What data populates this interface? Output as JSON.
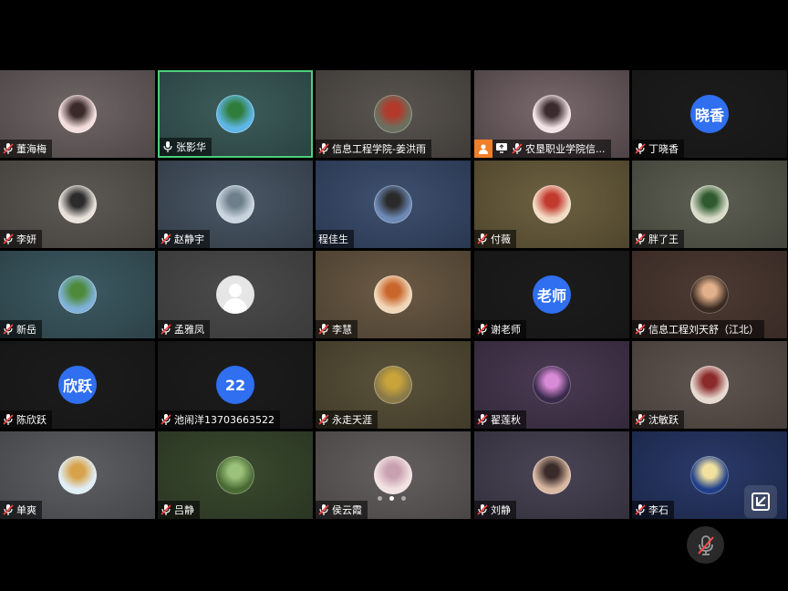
{
  "participants": [
    {
      "name": "董海梅",
      "mic": "muted",
      "avatar": {
        "kind": "pic",
        "bg": "#f4dede",
        "accent": "#3a2a2a"
      },
      "tile": [
        "#6f6666",
        "#4f4747"
      ]
    },
    {
      "name": "张影华",
      "mic": "on",
      "active": true,
      "avatar": {
        "kind": "pic",
        "bg": "#5fb6e6",
        "accent": "#2f7d3a"
      },
      "tile": [
        "#3d5d5a",
        "#2a4242"
      ]
    },
    {
      "name": "信息工程学院-姜洪雨",
      "mic": "muted",
      "avatar": {
        "kind": "pic",
        "bg": "#6a7060",
        "accent": "#b23a2a"
      },
      "tile": [
        "#5a5550",
        "#3f3b38"
      ]
    },
    {
      "name": "农垦职业学院信...",
      "mic": "muted",
      "host": true,
      "sharing": true,
      "avatar": {
        "kind": "pic",
        "bg": "#f1e3e6",
        "accent": "#3b2a2e"
      },
      "tile": [
        "#7a6a6e",
        "#4d4245"
      ]
    },
    {
      "name": "丁晓香",
      "mic": "muted",
      "avatar": {
        "kind": "text",
        "text": "晓香"
      },
      "tile": [
        "#1c1c1c",
        "#161616"
      ]
    },
    {
      "name": "李妍",
      "mic": "muted",
      "avatar": {
        "kind": "pic",
        "bg": "#e9e2da",
        "accent": "#2b2b2b"
      },
      "tile": [
        "#5d5a55",
        "#45423e"
      ]
    },
    {
      "name": "赵静宇",
      "mic": "muted",
      "avatar": {
        "kind": "pic",
        "bg": "#c9d4de",
        "accent": "#6d7f8a"
      },
      "tile": [
        "#4a5866",
        "#333c47"
      ]
    },
    {
      "name": "程佳生",
      "mic": "none",
      "avatar": {
        "kind": "pic",
        "bg": "#6d89b5",
        "accent": "#2a2a2a"
      },
      "tile": [
        "#3f5170",
        "#2a3750"
      ]
    },
    {
      "name": "付薇",
      "mic": "muted",
      "avatar": {
        "kind": "pic",
        "bg": "#f3dcc5",
        "accent": "#c23a2e"
      },
      "tile": [
        "#6d6140",
        "#4e452d"
      ]
    },
    {
      "name": "胖了王",
      "mic": "muted",
      "avatar": {
        "kind": "pic",
        "bg": "#d9dcc9",
        "accent": "#2f5a2f"
      },
      "tile": [
        "#5d5f53",
        "#43453c"
      ]
    },
    {
      "name": "新岳",
      "mic": "muted",
      "avatar": {
        "kind": "pic",
        "bg": "#7fb1d9",
        "accent": "#4e8a3a"
      },
      "tile": [
        "#3d5a63",
        "#2c4146"
      ]
    },
    {
      "name": "孟雅凤",
      "mic": "muted",
      "avatar": {
        "kind": "silhouette"
      },
      "tile": [
        "#4b4b4b",
        "#3a3a3a"
      ]
    },
    {
      "name": "李慧",
      "mic": "muted",
      "avatar": {
        "kind": "pic",
        "bg": "#f1d7b8",
        "accent": "#c9662c"
      },
      "tile": [
        "#6b5a45",
        "#4c4031"
      ]
    },
    {
      "name": "谢老师",
      "mic": "muted",
      "avatar": {
        "kind": "text",
        "text": "老师"
      },
      "tile": [
        "#1c1c1c",
        "#161616"
      ]
    },
    {
      "name": "信息工程刘天舒（江北）",
      "mic": "muted",
      "avatar": {
        "kind": "pic",
        "bg": "#3a2a22",
        "accent": "#e2b08a"
      },
      "tile": [
        "#4d3a33",
        "#382a25"
      ]
    },
    {
      "name": "陈欣跃",
      "mic": "muted",
      "avatar": {
        "kind": "text",
        "text": "欣跃"
      },
      "tile": [
        "#1c1c1c",
        "#161616"
      ]
    },
    {
      "name": "池闹洋13703663522",
      "mic": "muted",
      "avatar": {
        "kind": "text",
        "text": "22"
      },
      "tile": [
        "#1c1c1c",
        "#161616"
      ]
    },
    {
      "name": "永走天涯",
      "mic": "muted",
      "avatar": {
        "kind": "pic",
        "bg": "#8a7a4a",
        "accent": "#c9a43a"
      },
      "tile": [
        "#5a523a",
        "#403a29"
      ]
    },
    {
      "name": "翟莲秋",
      "mic": "muted",
      "avatar": {
        "kind": "pic",
        "bg": "#3a2a4a",
        "accent": "#d98ad6"
      },
      "tile": [
        "#4a3a52",
        "#33283a"
      ]
    },
    {
      "name": "沈敏跃",
      "mic": "muted",
      "avatar": {
        "kind": "pic",
        "bg": "#e7d9cf",
        "accent": "#8a2a2a"
      },
      "tile": [
        "#5f5550",
        "#463e3a"
      ]
    },
    {
      "name": "单爽",
      "mic": "muted",
      "avatar": {
        "kind": "pic",
        "bg": "#dfeef7",
        "accent": "#d8a24a"
      },
      "tile": [
        "#5d5f62",
        "#44464a"
      ]
    },
    {
      "name": "吕静",
      "mic": "muted",
      "avatar": {
        "kind": "pic",
        "bg": "#4a6a35",
        "accent": "#9bc27a"
      },
      "tile": [
        "#3a4a2f",
        "#2a3522"
      ]
    },
    {
      "name": "侯云霞",
      "mic": "muted",
      "avatar": {
        "kind": "pic",
        "bg": "#f2e3e3",
        "accent": "#c9a0b0"
      },
      "tile": [
        "#65605f",
        "#4a4646"
      ]
    },
    {
      "name": "刘静",
      "mic": "muted",
      "avatar": {
        "kind": "pic",
        "bg": "#d9b8a2",
        "accent": "#3a2a2a"
      },
      "tile": [
        "#4a4555",
        "#33303c"
      ]
    },
    {
      "name": "李石",
      "mic": "muted",
      "avatar": {
        "kind": "pic",
        "bg": "#1f3f8a",
        "accent": "#f2e2a0"
      },
      "tile": [
        "#2a3a6a",
        "#1c2748"
      ]
    }
  ],
  "pager": {
    "count": 3,
    "current": 1
  },
  "colors": {
    "active_border": "#4bd07b",
    "host_badge": "#f07e2a",
    "text_avatar": "#2f6ff0"
  },
  "icons": {
    "mic_muted": "mic-muted-icon",
    "mic_on": "mic-icon",
    "fullscreen": "exit-fullscreen-icon",
    "host": "host-icon",
    "share": "screen-share-icon"
  }
}
